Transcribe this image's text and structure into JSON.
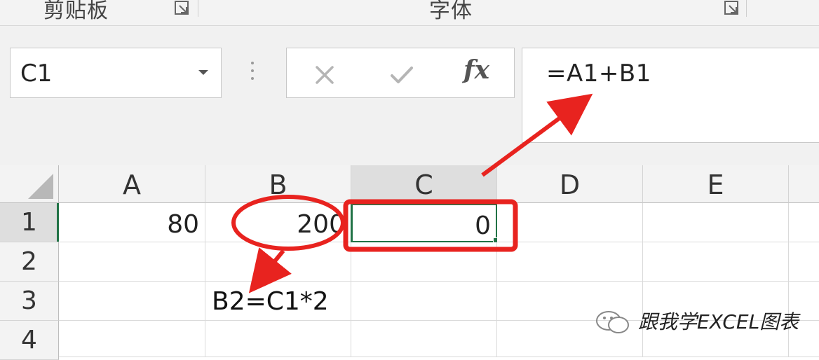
{
  "ribbon": {
    "clipboard_label": "剪贴板",
    "font_label": "字体"
  },
  "formula_bar": {
    "name_box": "C1",
    "cancel_icon": "x-icon",
    "enter_icon": "check-icon",
    "function_label": "fx",
    "formula": "=A1+B1"
  },
  "grid": {
    "columns": [
      "A",
      "B",
      "C",
      "D",
      "E"
    ],
    "rows": [
      "1",
      "2",
      "3",
      "4"
    ],
    "selected_column": "C",
    "selected_row": "1",
    "cells": {
      "A1": "80",
      "B1": "200",
      "C1": "0"
    }
  },
  "annotations": {
    "note": "B2=C1*2",
    "watermark": "跟我学EXCEL图表"
  },
  "colors": {
    "annotation_red": "#e8231f",
    "selection_green": "#217346"
  }
}
